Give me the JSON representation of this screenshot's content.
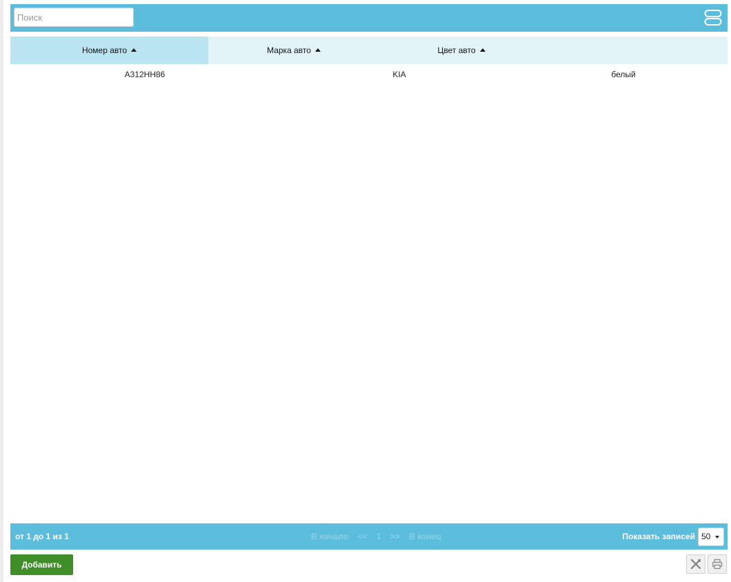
{
  "search": {
    "placeholder": "Поиск"
  },
  "columns": [
    {
      "label": "Номер авто",
      "sorted": "asc",
      "active": true
    },
    {
      "label": "Марка авто",
      "sorted": "asc",
      "active": false
    },
    {
      "label": "Цвет авто",
      "sorted": "asc",
      "active": false
    }
  ],
  "rows": [
    {
      "number": "А312НН86",
      "brand": "KIA",
      "color": "белый"
    }
  ],
  "footer": {
    "info": "от 1 до 1 из 1",
    "pager": {
      "first": "В начало",
      "prev": "<<",
      "page": "1",
      "next": ">>",
      "last": "В конец"
    },
    "page_size_label": "Показать записей",
    "page_size_value": "50"
  },
  "actions": {
    "add_label": "Добавить"
  },
  "icons": {
    "view_toggle": "view-toggle-icon",
    "excel": "excel-export-icon",
    "print": "print-icon"
  },
  "colors": {
    "toolbar_bg": "#5bbcdc",
    "header_bg": "#e2f4fa",
    "header_active_bg": "#bbe4f2",
    "add_button_bg": "#3f8e2a"
  }
}
